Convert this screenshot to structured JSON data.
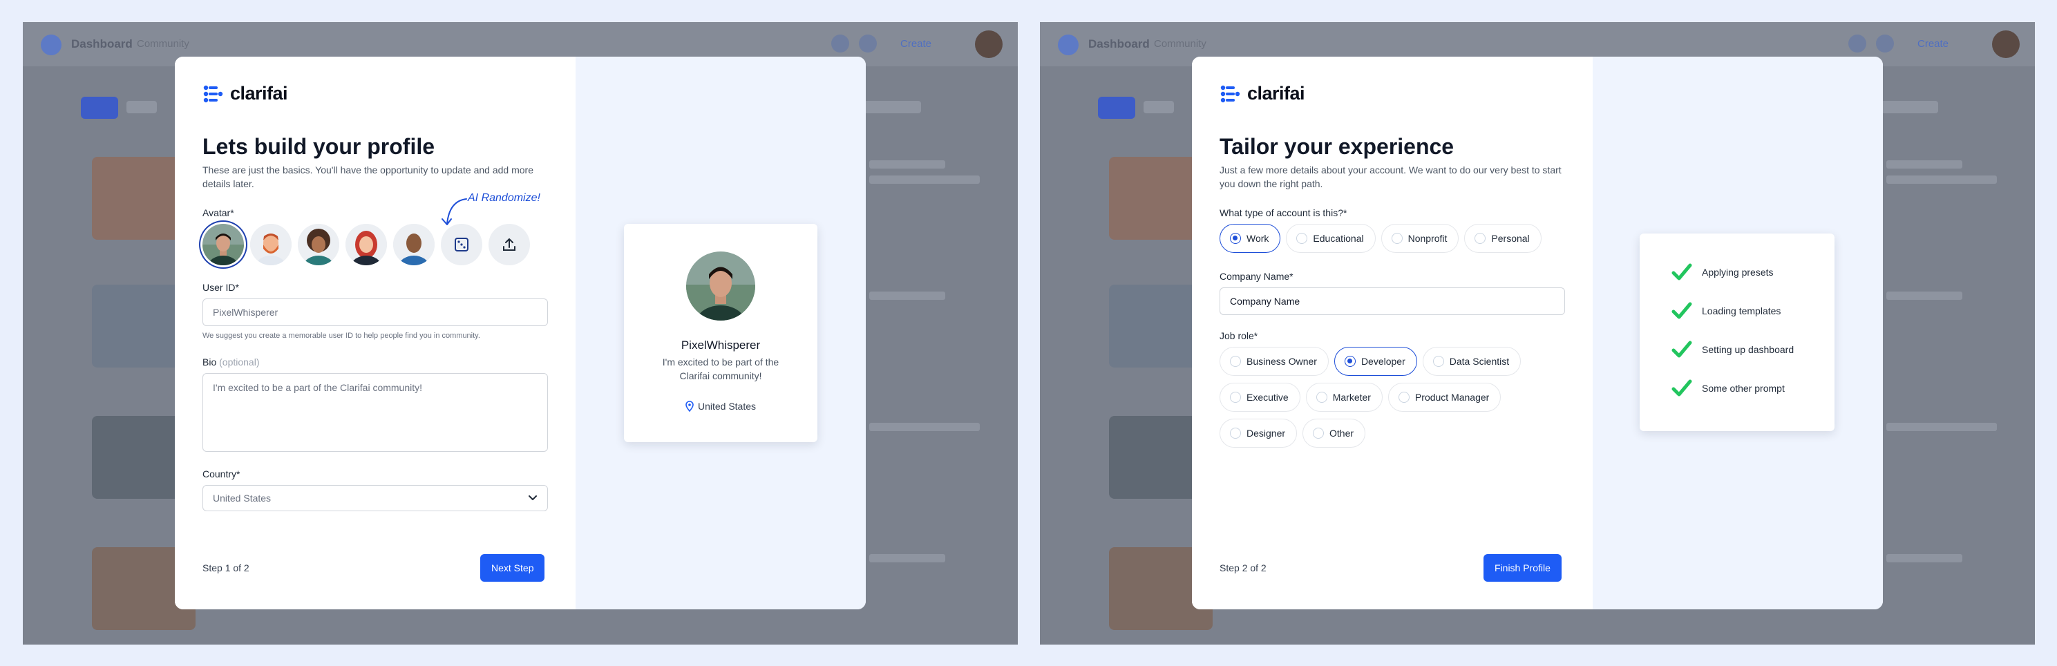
{
  "colors": {
    "accent": "#1e5cf5",
    "check": "#22c55e",
    "panel": "#eff4fe"
  },
  "background": {
    "app_title": "Dashboard",
    "app_subtitle": "Community",
    "create_label": "Create"
  },
  "brand": {
    "name": "clarifai"
  },
  "step1": {
    "title": "Lets build your profile",
    "subtitle": "These are just the basics. You'll have the opportunity to update and add more details later.",
    "avatar_label": "Avatar*",
    "ai_randomize": "AI Randomize!",
    "icons": {
      "randomize": "dice-icon",
      "upload": "upload-icon"
    },
    "user_id_label": "User ID*",
    "user_id_value": "PixelWhisperer",
    "user_id_hint": "We suggest you create a memorable user ID to help people find you in community.",
    "bio_label": "Bio",
    "bio_optional": "(optional)",
    "bio_value": "I'm excited to be a part of the Clarifai community!",
    "country_label": "Country*",
    "country_value": "United States",
    "step_text": "Step 1 of 2",
    "next_label": "Next Step",
    "preview": {
      "name": "PixelWhisperer",
      "bio": "I'm excited to be part of the Clarifai community!",
      "location": "United States"
    }
  },
  "step2": {
    "title": "Tailor your experience",
    "subtitle": "Just a few more details about your account. We want to do our very best to start you down the right path.",
    "account_type_label": "What type of account is this?*",
    "account_types": [
      "Work",
      "Educational",
      "Nonprofit",
      "Personal"
    ],
    "account_type_selected": "Work",
    "company_label": "Company Name*",
    "company_placeholder": "Company Name",
    "job_role_label": "Job role*",
    "job_roles": [
      "Business Owner",
      "Developer",
      "Data Scientist",
      "Executive",
      "Marketer",
      "Product Manager",
      "Designer",
      "Other"
    ],
    "job_role_selected": "Developer",
    "step_text": "Step 2 of 2",
    "finish_label": "Finish Profile",
    "checklist": [
      "Applying presets",
      "Loading templates",
      "Setting up dashboard",
      "Some other prompt"
    ]
  }
}
